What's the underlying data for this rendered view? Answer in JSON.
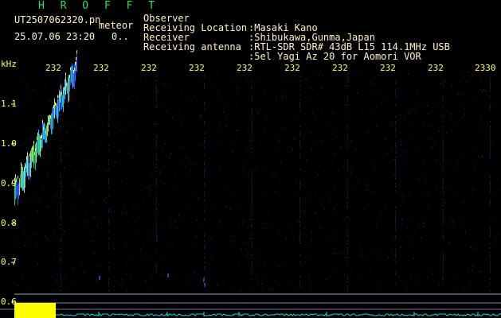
{
  "header": {
    "title": "H R O F F T",
    "file_name": "UT2507062320.pn",
    "mode": "meteor",
    "datetime": "25.07.06 23:20",
    "count": "0.."
  },
  "info": {
    "observer_label": "Observer",
    "observer_value": ":Masaki Kano",
    "location_label": "Receiving Location",
    "location_value": ":Shibukawa,Gunma,Japan",
    "receiver_label": "Receiver",
    "receiver_value": ":RTL-SDR SDR# 43dB L15 114.1MHz USB",
    "antenna_label": "Receiving antenna",
    "antenna_value": ":5el Yagi Az 20 for Aomori VOR"
  },
  "axes": {
    "y_unit": "kHz",
    "y_ticks": [
      "1.1",
      "1.0",
      "0.9",
      "0.8",
      "0.7",
      "0.6"
    ],
    "x_ticks": [
      "232",
      "232",
      "232",
      "232",
      "232",
      "232",
      "232",
      "232",
      "232",
      "2330"
    ]
  },
  "colors": {
    "text": "#fff2c8",
    "title": "#22e060",
    "axis_labels": "#ffff4a",
    "background": "#000000",
    "spectrum_bar": "#ffff00",
    "spectrum_line": "#00e0e0"
  }
}
